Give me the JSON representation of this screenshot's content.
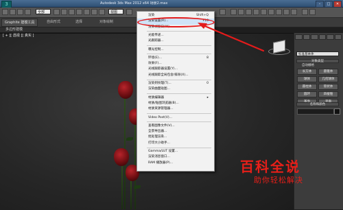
{
  "window": {
    "title": "Autodesk 3ds Max 2012 x64    场景2.max",
    "logo": "3",
    "buttons": [
      "minimize-icon",
      "maximize-icon",
      "close-icon"
    ]
  },
  "toolbar": {
    "selection_filter": "全部",
    "view_dropdown": "视图"
  },
  "ribbon": {
    "tab_label": "Graphite 建模工具",
    "sub_labels": [
      "自由形式",
      "选择",
      "对象绘制"
    ]
  },
  "mode_label": "多边形建模",
  "viewport": {
    "label": "[ + ][ 透视 ][ 真实 ]"
  },
  "menu": {
    "items": [
      {
        "label": "渲染",
        "shortcut": "Shift+Q"
      },
      {
        "label": "渲染设置(R)...",
        "shortcut": "F10",
        "highlight": true
      },
      {
        "label": "渲染帧窗口(W)...",
        "shortcut": ""
      },
      {
        "sep": true
      },
      {
        "label": "光能传递...",
        "shortcut": ""
      },
      {
        "label": "光跟踪器...",
        "shortcut": ""
      },
      {
        "sep": true
      },
      {
        "label": "曝光控制...",
        "shortcut": ""
      },
      {
        "sep": true
      },
      {
        "label": "环境(E)...",
        "shortcut": "8"
      },
      {
        "label": "效果(F)...",
        "shortcut": ""
      },
      {
        "label": "光线跟踪器设置(Y)...",
        "shortcut": ""
      },
      {
        "label": "光线跟踪全局包含/排除(X)...",
        "shortcut": ""
      },
      {
        "sep": true
      },
      {
        "label": "渲染到纹理(T)...",
        "shortcut": "0"
      },
      {
        "label": "渲染曲面贴图...",
        "shortcut": ""
      },
      {
        "sep": true
      },
      {
        "label": "材质编辑器",
        "shortcut": "▸"
      },
      {
        "label": "材质/贴图浏览器(B)...",
        "shortcut": ""
      },
      {
        "label": "材质资源管理器...",
        "shortcut": ""
      },
      {
        "sep": true
      },
      {
        "label": "Video Post(V)...",
        "shortcut": ""
      },
      {
        "sep": true
      },
      {
        "label": "查看图像文件(V)...",
        "shortcut": ""
      },
      {
        "label": "全景导出器...",
        "shortcut": ""
      },
      {
        "label": "批处理渲染...",
        "shortcut": ""
      },
      {
        "label": "打印大小助手...",
        "shortcut": ""
      },
      {
        "sep": true
      },
      {
        "label": "Gamma/LUT 设置...",
        "shortcut": ""
      },
      {
        "label": "渲染消息窗口...",
        "shortcut": ""
      },
      {
        "label": "RAM 播放器(P)...",
        "shortcut": ""
      }
    ]
  },
  "command_panel": {
    "combo": "标准基本体",
    "rollout_object_type": "对象类型",
    "autogrid": "自动栅格",
    "object_buttons": [
      "长方体",
      "圆锥体",
      "球体",
      "几何球体",
      "圆柱体",
      "管状体",
      "圆环",
      "四棱锥",
      "茶壶",
      "平面"
    ],
    "rollout_name_color": "名称和颜色"
  },
  "watermark": {
    "title": "百科全说",
    "subtitle": "助你轻松解决"
  },
  "colors": {
    "annotation_red": "#e41b1b",
    "menu_bg": "#f2f2f2",
    "menu_highlight": "#cfe3f7"
  }
}
